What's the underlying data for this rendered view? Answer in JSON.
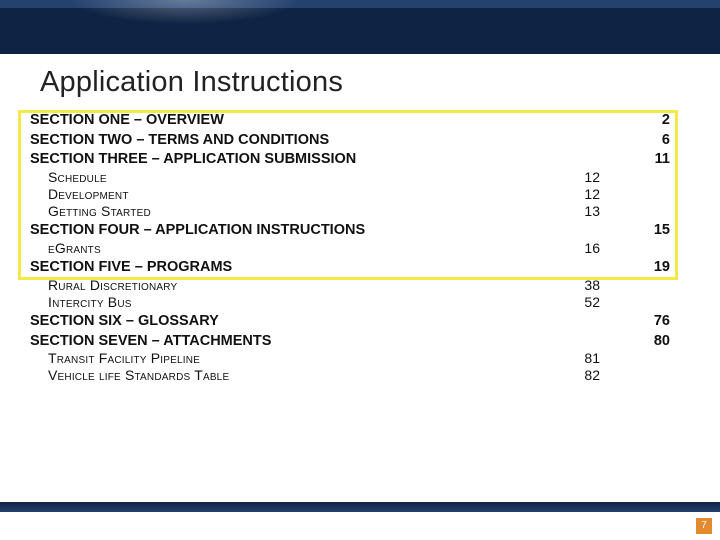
{
  "title": "Application Instructions",
  "page_number": "7",
  "sections": [
    {
      "label": "SECTION ONE – OVERVIEW",
      "page": "2"
    },
    {
      "label": "SECTION TWO – TERMS AND CONDITIONS",
      "page": "6"
    },
    {
      "label": "SECTION THREE – APPLICATION SUBMISSION",
      "page": "11",
      "subs": [
        {
          "label": "Schedule",
          "page": "12"
        },
        {
          "label": "Development",
          "page": "12"
        },
        {
          "label": "Getting Started",
          "page": "13"
        }
      ]
    },
    {
      "label": "SECTION FOUR – APPLICATION INSTRUCTIONS",
      "page": "15",
      "subs": [
        {
          "label": "eGrants",
          "page": "16"
        }
      ]
    },
    {
      "label": "SECTION FIVE – PROGRAMS",
      "page": "19",
      "subs": [
        {
          "label": "Rural Discretionary",
          "page": "38"
        },
        {
          "label": "Intercity Bus",
          "page": "52"
        }
      ]
    },
    {
      "label": "SECTION SIX – GLOSSARY",
      "page": "76"
    },
    {
      "label": "SECTION SEVEN – ATTACHMENTS",
      "page": "80",
      "subs": [
        {
          "label": "Transit Facility Pipeline",
          "page": "81"
        },
        {
          "label": "Vehicle life Standards Table",
          "page": "82"
        }
      ]
    }
  ]
}
